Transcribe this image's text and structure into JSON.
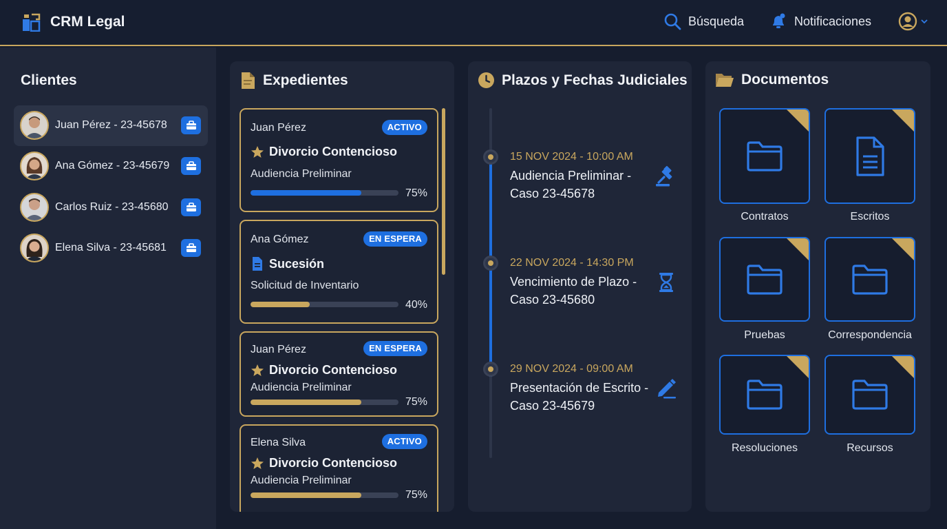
{
  "header": {
    "app_title": "CRM Legal",
    "search_label": "Búsqueda",
    "notifications_label": "Notificaciones"
  },
  "sidebar": {
    "title": "Clientes",
    "clients": [
      {
        "label": "Juan Pérez - 23-45678"
      },
      {
        "label": "Ana Gómez - 23-45679"
      },
      {
        "label": "Carlos Ruiz - 23-45680"
      },
      {
        "label": "Elena Silva - 23-45681"
      }
    ]
  },
  "expedientes": {
    "title": "Expedientes",
    "cards": [
      {
        "client": "Juan Pérez",
        "status": "ACTIVO",
        "type": "Divorcio Contencioso",
        "stage": "Audiencia Preliminar",
        "progress_pct": 75,
        "progress_label": "75%",
        "icon": "star-icon"
      },
      {
        "client": "Ana Gómez",
        "status": "EN ESPERA",
        "type": "Sucesión",
        "stage": "Solicitud de Inventario",
        "progress_pct": 40,
        "progress_label": "40%",
        "icon": "document-icon"
      },
      {
        "client": "Juan Pérez",
        "status": "EN ESPERA",
        "type": "Divorcio Contencioso",
        "stage": "Audiencia Preliminar",
        "progress_pct": 75,
        "progress_label": "75%",
        "icon": "star-icon"
      },
      {
        "client": "Elena Silva",
        "status": "ACTIVO",
        "type": "Divorcio Contencioso",
        "stage": "Audiencia Preliminar",
        "progress_pct": 75,
        "progress_label": "75%",
        "icon": "star-icon"
      }
    ]
  },
  "plazos": {
    "title": "Plazos y Fechas Judiciales",
    "events": [
      {
        "date": "15 NOV 2024 - 10:00 AM",
        "line1": "Audiencia Preliminar -",
        "line2": "Caso 23-45678",
        "icon": "gavel-icon"
      },
      {
        "date": "22 NOV 2024 - 14:30 PM",
        "line1": "Vencimiento de Plazo -",
        "line2": "Caso 23-45680",
        "icon": "hourglass-icon"
      },
      {
        "date": "29 NOV 2024 - 09:00 AM",
        "line1": "Presentación de Escrito -",
        "line2": "Caso 23-45679",
        "icon": "pen-icon"
      }
    ]
  },
  "documentos": {
    "title": "Documentos",
    "folders": [
      {
        "label": "Contratos",
        "icon": "folder-icon"
      },
      {
        "label": "Escritos",
        "icon": "document-icon"
      },
      {
        "label": "Pruebas",
        "icon": "folder-icon"
      },
      {
        "label": "Correspondencia",
        "icon": "folder-icon"
      },
      {
        "label": "Resoluciones",
        "icon": "folder-icon"
      },
      {
        "label": "Recursos",
        "icon": "folder-icon"
      }
    ]
  },
  "colors": {
    "accent_gold": "#c9a75e",
    "accent_blue": "#1e6fe0",
    "background": "#161d2e",
    "panel": "#1f2638"
  }
}
